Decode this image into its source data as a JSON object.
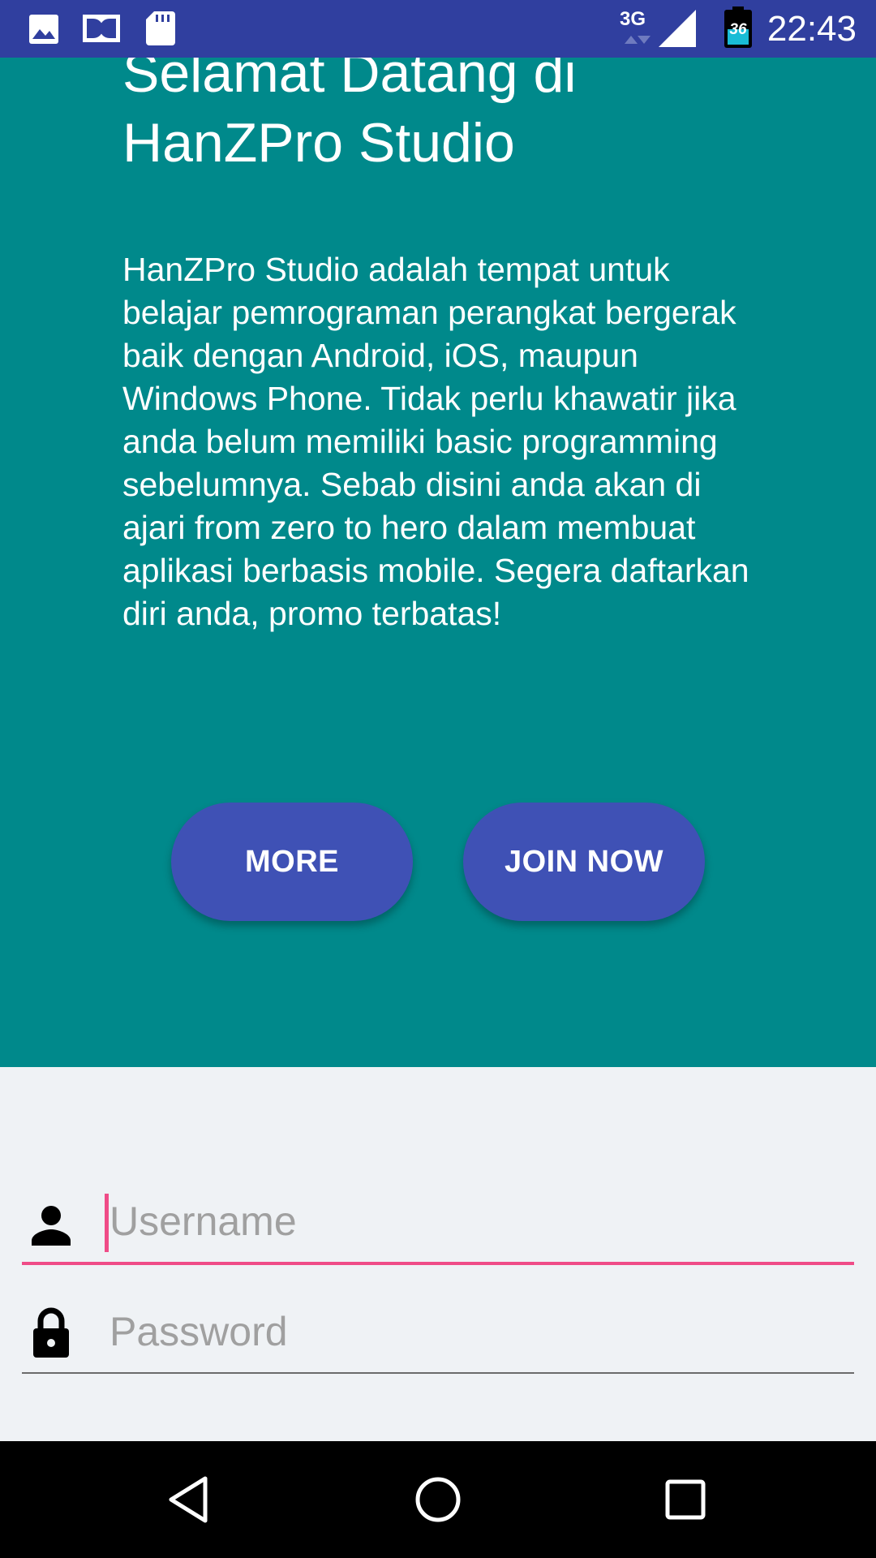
{
  "status_bar": {
    "network": "3G",
    "battery_level": "36",
    "time": "22:43",
    "icons": [
      "gallery-icon",
      "dolby-icon",
      "sd-card-icon",
      "signal-icon",
      "battery-icon"
    ]
  },
  "hero": {
    "title": "Selamat Datang di HanZPro Studio",
    "description": "HanZPro Studio adalah tempat untuk belajar pemrograman perangkat bergerak baik dengan Android, iOS, maupun Windows Phone. Tidak perlu khawatir jika anda belum memiliki basic programming sebelumnya. Sebab disini anda akan di ajari from zero to hero dalam membuat aplikasi berbasis mobile. Segera daftarkan diri anda, promo terbatas!",
    "more_label": "MORE",
    "join_label": "JOIN NOW"
  },
  "form": {
    "username_placeholder": "Username",
    "username_value": "",
    "password_placeholder": "Password",
    "password_value": ""
  },
  "nav": {
    "icons": [
      "back-icon",
      "home-icon",
      "recents-icon"
    ]
  },
  "colors": {
    "status_bar": "#303f9f",
    "hero_bg": "#00898b",
    "button_bg": "#3f51b5",
    "accent": "#ef4c87",
    "form_bg": "#eff2f5"
  }
}
